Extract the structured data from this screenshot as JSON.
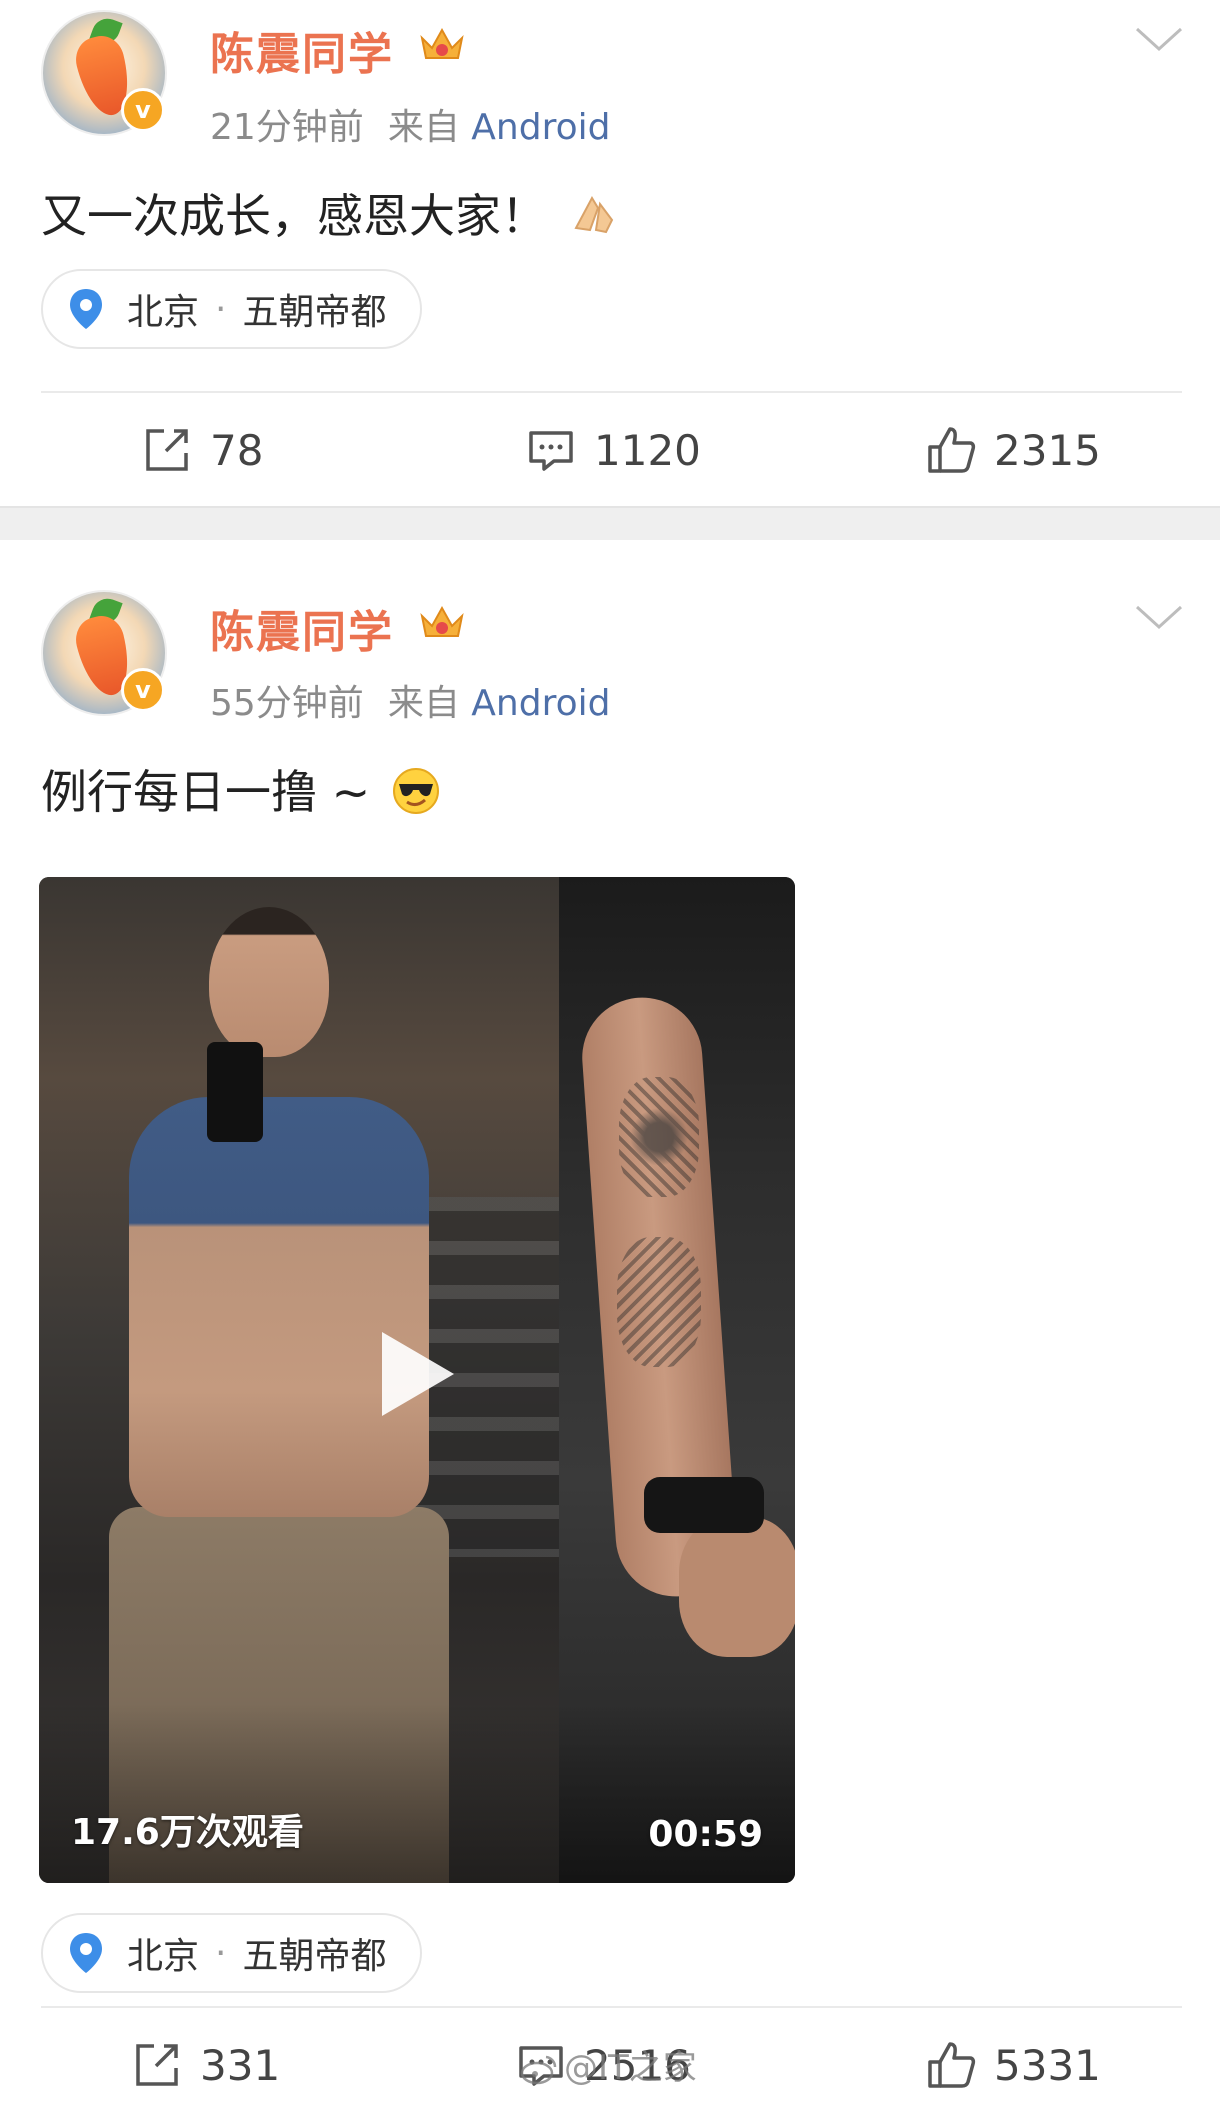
{
  "posts": [
    {
      "username": "陈震同学",
      "time": "21分钟前",
      "from_label": "来自",
      "source": "Android",
      "text": "又一次成长，感恩大家！",
      "location": {
        "city": "北京",
        "dot": "·",
        "tagline": "五朝帝都"
      },
      "actions": {
        "reposts": "78",
        "comments": "1120",
        "likes": "2315"
      }
    },
    {
      "username": "陈震同学",
      "time": "55分钟前",
      "from_label": "来自",
      "source": "Android",
      "text": "例行每日一撸 ~",
      "video": {
        "views": "17.6万次观看",
        "duration": "00:59"
      },
      "location": {
        "city": "北京",
        "dot": "·",
        "tagline": "五朝帝都"
      },
      "actions": {
        "reposts": "331",
        "comments": "2516",
        "likes": "5331"
      }
    }
  ],
  "watermark": "@IT之家",
  "colors": {
    "username": "#eb7350",
    "source_link": "#4e6fa8",
    "verified_badge": "#f6a623",
    "pin": "#3d8ee8"
  }
}
